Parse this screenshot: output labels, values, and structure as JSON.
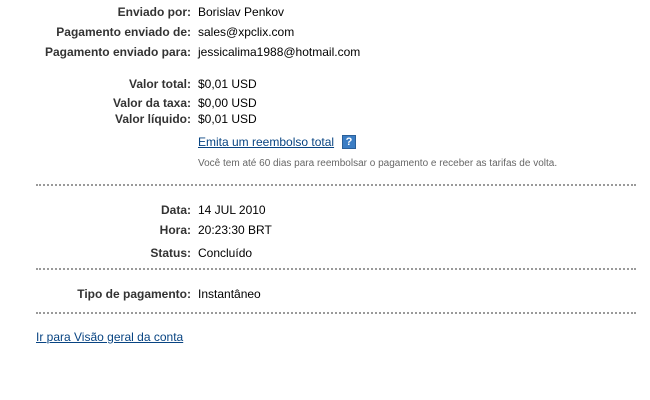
{
  "sender": {
    "sent_by_label": "Enviado por:",
    "sent_by_value": "Borislav Penkov",
    "from_label": "Pagamento enviado de:",
    "from_value": "sales@xpclix.com",
    "to_label": "Pagamento enviado para:",
    "to_value": "jessicalima1988@hotmail.com"
  },
  "amounts": {
    "total_label": "Valor total:",
    "total_value": "$0,01 USD",
    "fee_label": "Valor da taxa:",
    "fee_value": "$0,00 USD",
    "net_label": "Valor líquido:",
    "net_value": "$0,01 USD",
    "refund_link": "Emita um reembolso total",
    "help_icon_glyph": "?",
    "refund_note": "Você tem até 60 dias para reembolsar o pagamento e receber as tarifas de volta."
  },
  "details": {
    "date_label": "Data:",
    "date_value": "14 JUL 2010",
    "time_label": "Hora:",
    "time_value": "20:23:30 BRT",
    "status_label": "Status:",
    "status_value": "Concluído"
  },
  "payment_type": {
    "label": "Tipo de pagamento:",
    "value": "Instantâneo"
  },
  "footer": {
    "overview_link": "Ir para Visão geral da conta"
  },
  "colors": {
    "link": "#084482",
    "help_icon": "#3b7dc4",
    "note_text": "#666666",
    "divider": "#9a9a9a"
  }
}
